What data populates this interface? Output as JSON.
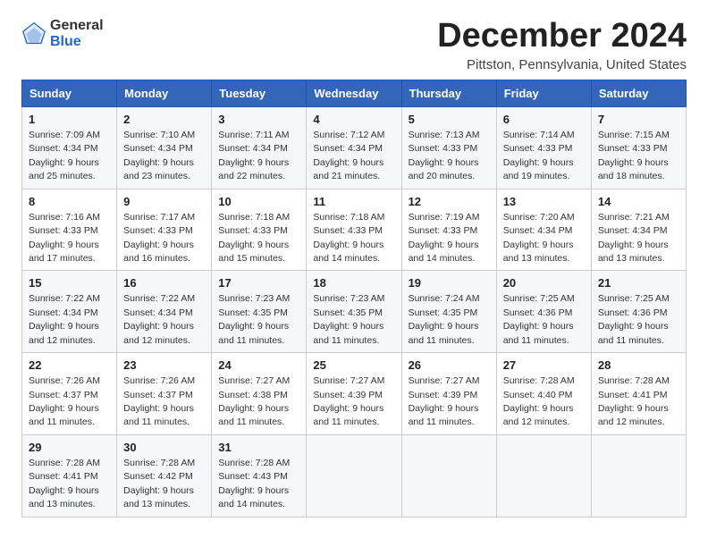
{
  "header": {
    "logo_general": "General",
    "logo_blue": "Blue",
    "month_title": "December 2024",
    "location": "Pittston, Pennsylvania, United States"
  },
  "weekdays": [
    "Sunday",
    "Monday",
    "Tuesday",
    "Wednesday",
    "Thursday",
    "Friday",
    "Saturday"
  ],
  "weeks": [
    [
      {
        "day": "1",
        "sunrise": "Sunrise: 7:09 AM",
        "sunset": "Sunset: 4:34 PM",
        "daylight": "Daylight: 9 hours and 25 minutes."
      },
      {
        "day": "2",
        "sunrise": "Sunrise: 7:10 AM",
        "sunset": "Sunset: 4:34 PM",
        "daylight": "Daylight: 9 hours and 23 minutes."
      },
      {
        "day": "3",
        "sunrise": "Sunrise: 7:11 AM",
        "sunset": "Sunset: 4:34 PM",
        "daylight": "Daylight: 9 hours and 22 minutes."
      },
      {
        "day": "4",
        "sunrise": "Sunrise: 7:12 AM",
        "sunset": "Sunset: 4:34 PM",
        "daylight": "Daylight: 9 hours and 21 minutes."
      },
      {
        "day": "5",
        "sunrise": "Sunrise: 7:13 AM",
        "sunset": "Sunset: 4:33 PM",
        "daylight": "Daylight: 9 hours and 20 minutes."
      },
      {
        "day": "6",
        "sunrise": "Sunrise: 7:14 AM",
        "sunset": "Sunset: 4:33 PM",
        "daylight": "Daylight: 9 hours and 19 minutes."
      },
      {
        "day": "7",
        "sunrise": "Sunrise: 7:15 AM",
        "sunset": "Sunset: 4:33 PM",
        "daylight": "Daylight: 9 hours and 18 minutes."
      }
    ],
    [
      {
        "day": "8",
        "sunrise": "Sunrise: 7:16 AM",
        "sunset": "Sunset: 4:33 PM",
        "daylight": "Daylight: 9 hours and 17 minutes."
      },
      {
        "day": "9",
        "sunrise": "Sunrise: 7:17 AM",
        "sunset": "Sunset: 4:33 PM",
        "daylight": "Daylight: 9 hours and 16 minutes."
      },
      {
        "day": "10",
        "sunrise": "Sunrise: 7:18 AM",
        "sunset": "Sunset: 4:33 PM",
        "daylight": "Daylight: 9 hours and 15 minutes."
      },
      {
        "day": "11",
        "sunrise": "Sunrise: 7:18 AM",
        "sunset": "Sunset: 4:33 PM",
        "daylight": "Daylight: 9 hours and 14 minutes."
      },
      {
        "day": "12",
        "sunrise": "Sunrise: 7:19 AM",
        "sunset": "Sunset: 4:33 PM",
        "daylight": "Daylight: 9 hours and 14 minutes."
      },
      {
        "day": "13",
        "sunrise": "Sunrise: 7:20 AM",
        "sunset": "Sunset: 4:34 PM",
        "daylight": "Daylight: 9 hours and 13 minutes."
      },
      {
        "day": "14",
        "sunrise": "Sunrise: 7:21 AM",
        "sunset": "Sunset: 4:34 PM",
        "daylight": "Daylight: 9 hours and 13 minutes."
      }
    ],
    [
      {
        "day": "15",
        "sunrise": "Sunrise: 7:22 AM",
        "sunset": "Sunset: 4:34 PM",
        "daylight": "Daylight: 9 hours and 12 minutes."
      },
      {
        "day": "16",
        "sunrise": "Sunrise: 7:22 AM",
        "sunset": "Sunset: 4:34 PM",
        "daylight": "Daylight: 9 hours and 12 minutes."
      },
      {
        "day": "17",
        "sunrise": "Sunrise: 7:23 AM",
        "sunset": "Sunset: 4:35 PM",
        "daylight": "Daylight: 9 hours and 11 minutes."
      },
      {
        "day": "18",
        "sunrise": "Sunrise: 7:23 AM",
        "sunset": "Sunset: 4:35 PM",
        "daylight": "Daylight: 9 hours and 11 minutes."
      },
      {
        "day": "19",
        "sunrise": "Sunrise: 7:24 AM",
        "sunset": "Sunset: 4:35 PM",
        "daylight": "Daylight: 9 hours and 11 minutes."
      },
      {
        "day": "20",
        "sunrise": "Sunrise: 7:25 AM",
        "sunset": "Sunset: 4:36 PM",
        "daylight": "Daylight: 9 hours and 11 minutes."
      },
      {
        "day": "21",
        "sunrise": "Sunrise: 7:25 AM",
        "sunset": "Sunset: 4:36 PM",
        "daylight": "Daylight: 9 hours and 11 minutes."
      }
    ],
    [
      {
        "day": "22",
        "sunrise": "Sunrise: 7:26 AM",
        "sunset": "Sunset: 4:37 PM",
        "daylight": "Daylight: 9 hours and 11 minutes."
      },
      {
        "day": "23",
        "sunrise": "Sunrise: 7:26 AM",
        "sunset": "Sunset: 4:37 PM",
        "daylight": "Daylight: 9 hours and 11 minutes."
      },
      {
        "day": "24",
        "sunrise": "Sunrise: 7:27 AM",
        "sunset": "Sunset: 4:38 PM",
        "daylight": "Daylight: 9 hours and 11 minutes."
      },
      {
        "day": "25",
        "sunrise": "Sunrise: 7:27 AM",
        "sunset": "Sunset: 4:39 PM",
        "daylight": "Daylight: 9 hours and 11 minutes."
      },
      {
        "day": "26",
        "sunrise": "Sunrise: 7:27 AM",
        "sunset": "Sunset: 4:39 PM",
        "daylight": "Daylight: 9 hours and 11 minutes."
      },
      {
        "day": "27",
        "sunrise": "Sunrise: 7:28 AM",
        "sunset": "Sunset: 4:40 PM",
        "daylight": "Daylight: 9 hours and 12 minutes."
      },
      {
        "day": "28",
        "sunrise": "Sunrise: 7:28 AM",
        "sunset": "Sunset: 4:41 PM",
        "daylight": "Daylight: 9 hours and 12 minutes."
      }
    ],
    [
      {
        "day": "29",
        "sunrise": "Sunrise: 7:28 AM",
        "sunset": "Sunset: 4:41 PM",
        "daylight": "Daylight: 9 hours and 13 minutes."
      },
      {
        "day": "30",
        "sunrise": "Sunrise: 7:28 AM",
        "sunset": "Sunset: 4:42 PM",
        "daylight": "Daylight: 9 hours and 13 minutes."
      },
      {
        "day": "31",
        "sunrise": "Sunrise: 7:28 AM",
        "sunset": "Sunset: 4:43 PM",
        "daylight": "Daylight: 9 hours and 14 minutes."
      },
      null,
      null,
      null,
      null
    ]
  ]
}
